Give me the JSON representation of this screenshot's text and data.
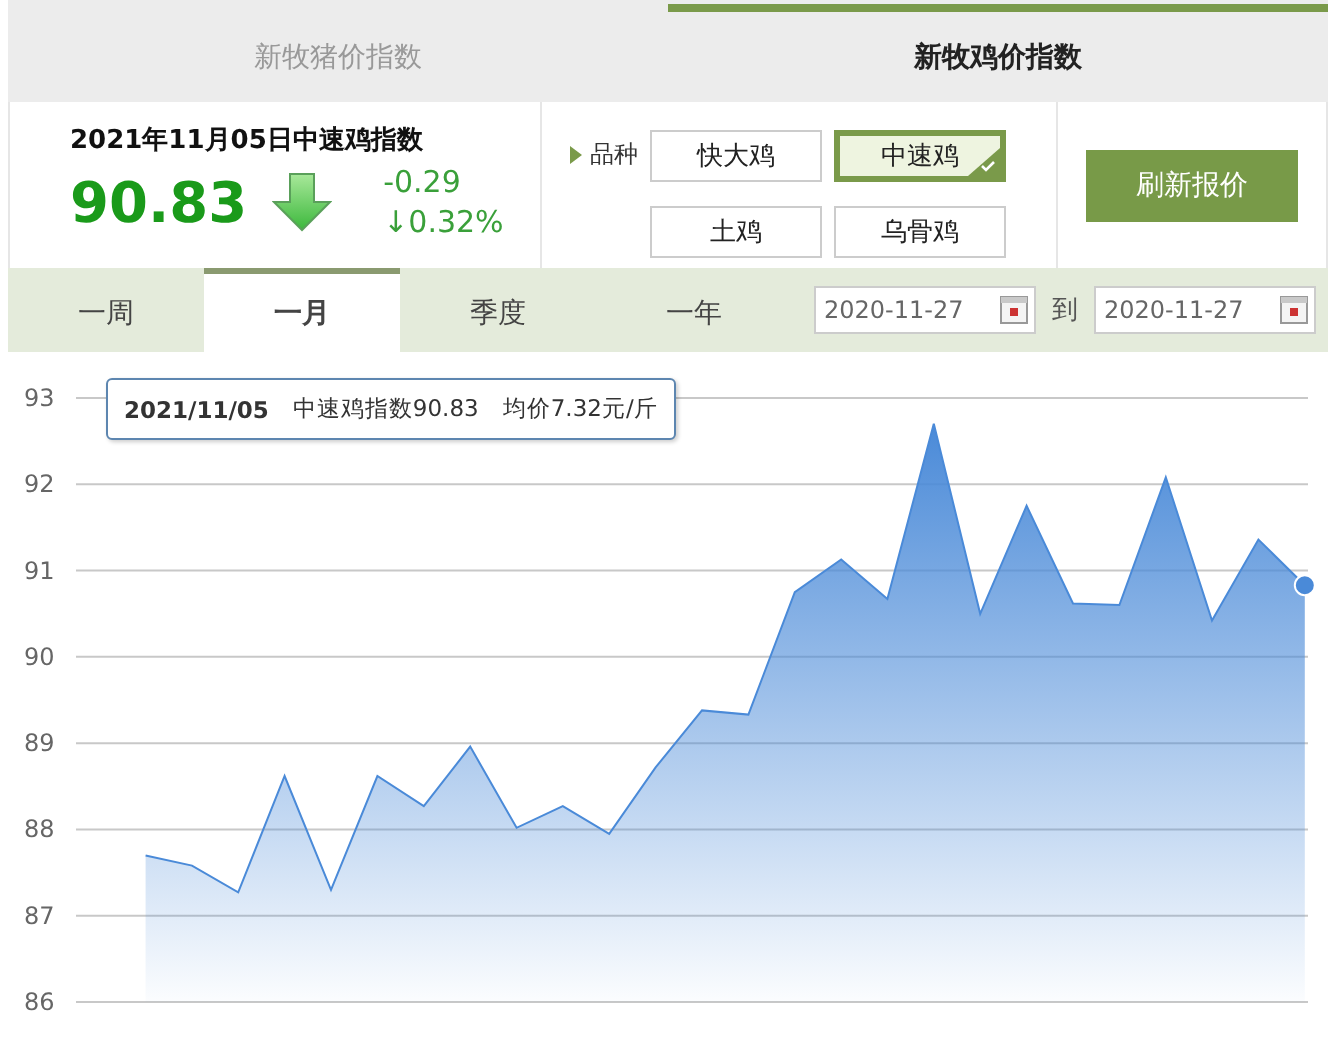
{
  "source_tabs": [
    {
      "label": "新牧猪价指数",
      "selected": false
    },
    {
      "label": "新牧鸡价指数",
      "selected": true
    }
  ],
  "index_panel": {
    "title": "2021年11月05日中速鸡指数",
    "value": "90.83",
    "falling": true,
    "change": "-0.29",
    "change_percent": "↓0.32%"
  },
  "variety": {
    "label": "品种",
    "options": [
      {
        "label": "快大鸡",
        "selected": false
      },
      {
        "label": "中速鸡",
        "selected": true
      },
      {
        "label": "土鸡",
        "selected": false
      },
      {
        "label": "乌骨鸡",
        "selected": false
      }
    ]
  },
  "refresh_button": "刷新报价",
  "period_tabs": [
    {
      "label": "一周",
      "selected": false
    },
    {
      "label": "一月",
      "selected": true
    },
    {
      "label": "季度",
      "selected": false
    },
    {
      "label": "一年",
      "selected": false
    }
  ],
  "date_range": {
    "from": "2020-11-27",
    "separator": "到",
    "to": "2020-11-27"
  },
  "chart": {
    "tooltip": {
      "date": "2021/11/05",
      "index": "中速鸡指数90.83",
      "price": "均价7.32元/斤"
    },
    "chart_data": {
      "type": "area",
      "grid": true,
      "ylim": [
        86,
        93
      ],
      "yticks": [
        86,
        87,
        88,
        89,
        90,
        91,
        92,
        93
      ],
      "categories": [
        null,
        null,
        null,
        null,
        null,
        null,
        null,
        null,
        null,
        null,
        null,
        null,
        null,
        null,
        null,
        null,
        null,
        null,
        null,
        null,
        null,
        null,
        null,
        null,
        null,
        null,
        null
      ],
      "series": [
        {
          "color": "#4a8ad8",
          "values": [
            null,
            87.7,
            87.58,
            87.27,
            88.62,
            87.3,
            88.62,
            88.27,
            88.96,
            88.02,
            88.27,
            87.95,
            88.72,
            89.38,
            89.33,
            90.75,
            91.13,
            90.67,
            92.7,
            90.5,
            91.75,
            90.62,
            90.6,
            92.08,
            90.42,
            91.36,
            90.83
          ]
        }
      ]
    }
  }
}
